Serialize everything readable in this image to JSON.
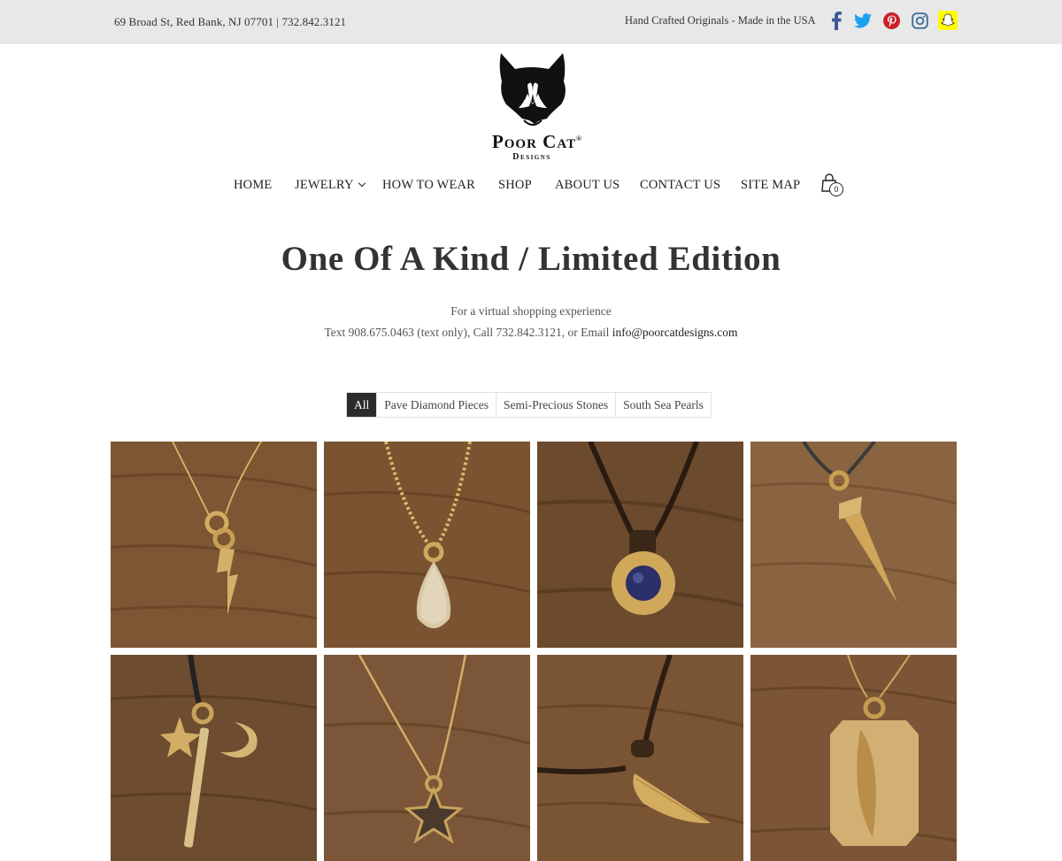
{
  "topbar": {
    "address": "69 Broad St, Red Bank, NJ 07701 | 732.842.3121",
    "tagline": "Hand Crafted Originals - Made in the USA",
    "social": [
      {
        "icon": "facebook-icon",
        "color": "#3b5998"
      },
      {
        "icon": "twitter-icon",
        "color": "#1da1f2"
      },
      {
        "icon": "pinterest-icon",
        "color": "#cb2027"
      },
      {
        "icon": "instagram-icon",
        "color": "#3f729b"
      },
      {
        "icon": "snapchat-icon",
        "color": "#fffc00"
      }
    ]
  },
  "logo": {
    "brand": "Poor Cat",
    "registered": "®",
    "sub": "Designs"
  },
  "nav": {
    "items": [
      "HOME",
      "JEWELRY",
      "HOW TO WEAR",
      "SHOP",
      "ABOUT US",
      "CONTACT US",
      "SITE MAP"
    ],
    "cart_count": "0"
  },
  "page": {
    "title": "One Of A Kind / Limited Edition",
    "intro_line1": "For a virtual shopping experience",
    "intro_line2": "Text 908.675.0463 (text only), Call 732.842.3121, or Email",
    "email": "info@poorcatdesigns.com"
  },
  "filters": {
    "items": [
      "All",
      "Pave Diamond Pieces",
      "Semi-Precious Stones",
      "South Sea Pearls"
    ],
    "active": "All"
  },
  "products": [
    {
      "icon": "lightning-bolt-pendant-icon"
    },
    {
      "icon": "pave-teardrop-pendant-icon"
    },
    {
      "icon": "sapphire-bezel-pendant-icon"
    },
    {
      "icon": "dagger-pendant-icon"
    },
    {
      "icon": "star-moon-bar-charms-icon"
    },
    {
      "icon": "star-pendant-icon"
    },
    {
      "icon": "feather-leather-pendant-icon"
    },
    {
      "icon": "feather-dog-tag-pendant-icon"
    }
  ],
  "colors": {
    "topbar_bg": "#e8e8e8",
    "wood": "#7a5534",
    "gold": "#c9a35a",
    "active_filter": "#2b2b2b"
  }
}
